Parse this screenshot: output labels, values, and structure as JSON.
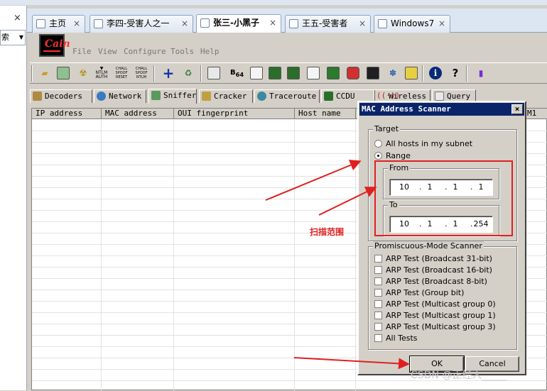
{
  "left_pane": {
    "close": "×",
    "selector_text": "索"
  },
  "vm_tabs": [
    {
      "label": "主页"
    },
    {
      "label": "李四-受害人之一"
    },
    {
      "label": "张三-小黑子"
    },
    {
      "label": "王五-受害者"
    },
    {
      "label": "Windows7"
    }
  ],
  "vm_tab_close": "×",
  "cain": {
    "logo_text": "Cain",
    "menu": [
      "File",
      "View",
      "Configure",
      "Tools",
      "Help"
    ],
    "module_tabs": [
      "Decoders",
      "Network",
      "Sniffer",
      "Cracker",
      "Traceroute",
      "CCDU",
      "Wireless",
      "Query"
    ],
    "columns": [
      "IP address",
      "MAC address",
      "OUI fingerprint",
      "Host name",
      "M1"
    ]
  },
  "dialog": {
    "title": "MAC Address Scanner",
    "close": "×",
    "target_group": "Target",
    "options": [
      "All hosts in my subnet",
      "Range"
    ],
    "selected_option": "Range",
    "from_label": "From",
    "to_label": "To",
    "from_ip": [
      "10",
      "1",
      "1",
      "1"
    ],
    "to_ip": [
      "10",
      "1",
      "1",
      "254"
    ],
    "promiscuous_group": "Promiscuous-Mode Scanner",
    "tests": [
      "ARP Test (Broadcast 31-bit)",
      "ARP Test (Broadcast 16-bit)",
      "ARP Test (Broadcast 8-bit)",
      "ARP Test (Group bit)",
      "ARP Test (Multicast group 0)",
      "ARP Test (Multicast group 1)",
      "ARP Test (Multicast group 3)",
      "All Tests"
    ],
    "ok_label": "OK",
    "cancel_label": "Cancel"
  },
  "annotation": {
    "text": "扫描范围",
    "color": "#e02020"
  },
  "watermark": "CSDN @正经人_____",
  "colors": {
    "title_bar": "#0a246a",
    "annotation_red": "#e02020"
  }
}
